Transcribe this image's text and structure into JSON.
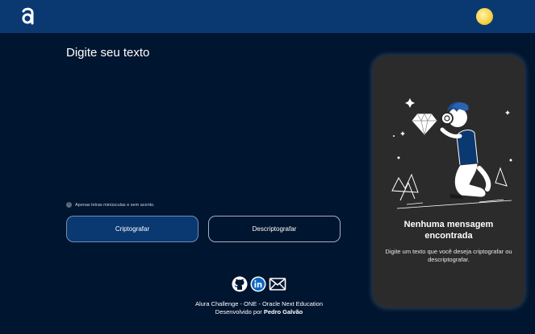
{
  "header": {
    "logo_icon": "alura-logo-icon",
    "avatar_icon": "moon-avatar-icon"
  },
  "main": {
    "title": "Digite seu texto",
    "hint": "Apenas letras minúsculas e sem acento.",
    "hint_icon": "info-icon",
    "encrypt_label": "Criptografar",
    "decrypt_label": "Descriptografar"
  },
  "social": {
    "icons": [
      "github-icon",
      "linkedin-icon",
      "mail-icon"
    ]
  },
  "footer": {
    "line1": "Alura Challenge - ONE - Oracle Next Education",
    "line2_prefix": "Desenvolvido por",
    "author": "Pedro Galvão"
  },
  "result_panel": {
    "title": "Nenhuma mensagem encontrada",
    "text": "Digite um texto que você deseja criptografar ou descriptografar.",
    "illustration": "person-with-magnifier-illustration"
  },
  "colors": {
    "background": "#00152f",
    "header": "#0a3871",
    "panel": "#2b2b2b",
    "accent": "#0a3871"
  }
}
